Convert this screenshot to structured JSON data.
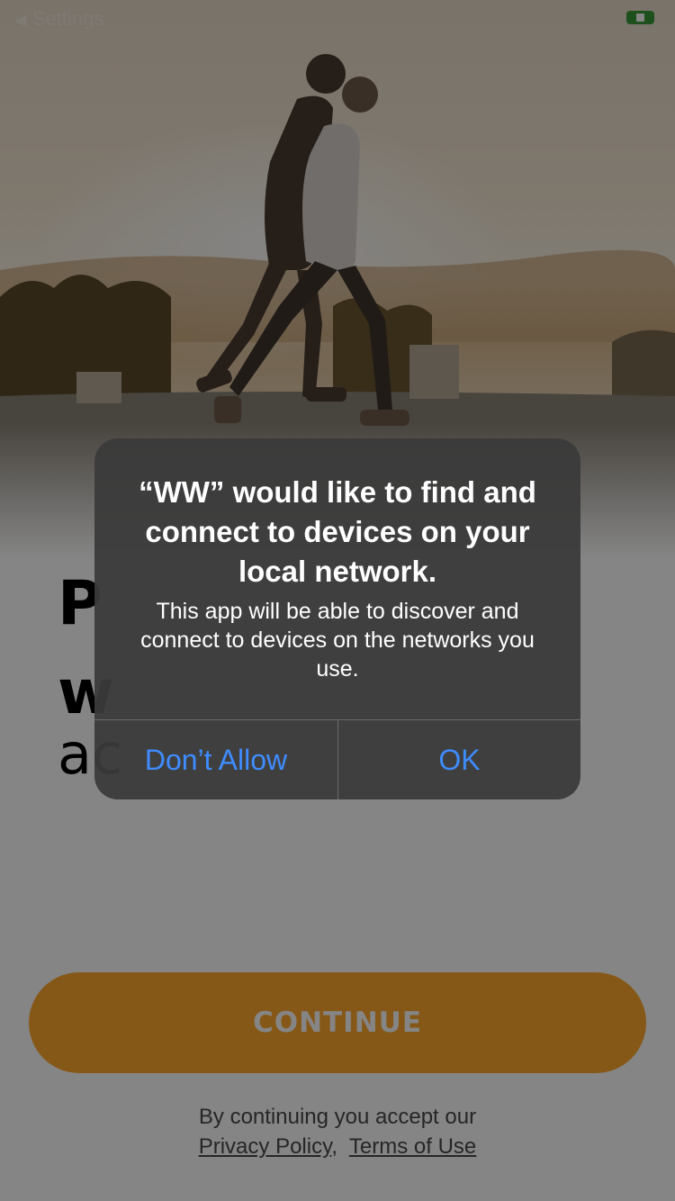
{
  "status_bar": {
    "back_label": "Settings",
    "back_icon": "chevron-left-icon",
    "battery_icon": "battery-charging-icon",
    "battery_color": "#3a9a38"
  },
  "onboarding": {
    "hero_image": "couple-walking-at-sunset",
    "headline_line1": "P",
    "headline_line2": "w",
    "headline_line3": "ac",
    "continue_label": "CONTINUE",
    "legal_text": "By continuing you accept our",
    "privacy_link": "Privacy Policy",
    "legal_separator": ",",
    "terms_link": "Terms of Use",
    "accent_color": "#ffa92e"
  },
  "alert": {
    "title": "“WW” would like to find and connect to devices on your local network.",
    "message": "This app will be able to discover and connect to devices on the networks you use.",
    "dont_allow_label": "Don’t Allow",
    "ok_label": "OK",
    "button_color": "#3f8cff"
  }
}
